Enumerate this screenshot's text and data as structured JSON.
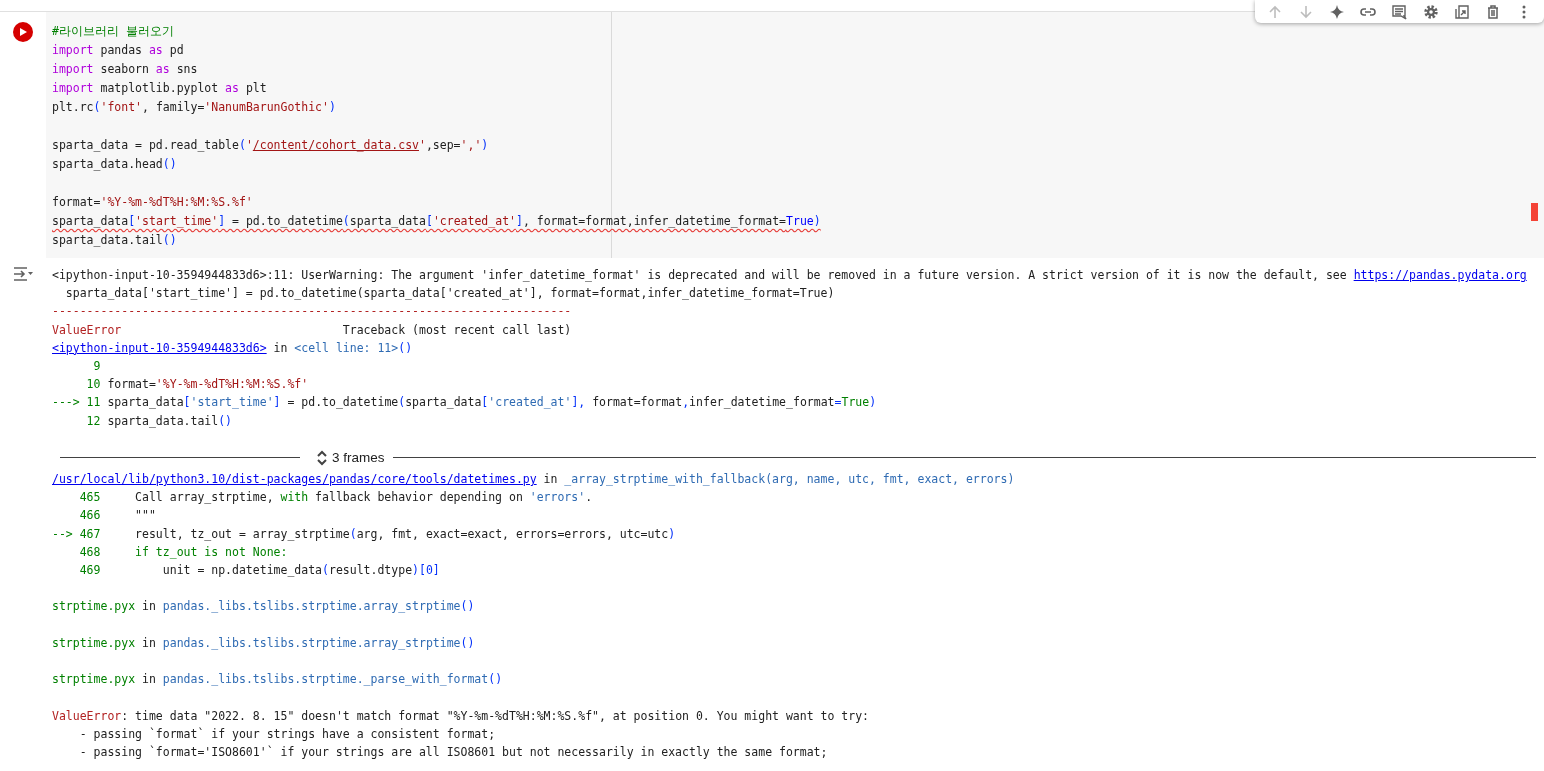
{
  "toolbar": [
    {
      "kind": "move_up",
      "disabled": true
    },
    {
      "kind": "move_down",
      "disabled": true
    },
    {
      "kind": "sparkle",
      "disabled": false
    },
    {
      "kind": "link",
      "disabled": false
    },
    {
      "kind": "comment",
      "disabled": false
    },
    {
      "kind": "settings",
      "disabled": false
    },
    {
      "kind": "mirror",
      "disabled": false
    },
    {
      "kind": "delete",
      "disabled": false
    },
    {
      "kind": "more",
      "disabled": false
    }
  ],
  "cell": {
    "code_blocks": [
      [
        {
          "warning": false,
          "tokens": [
            {
              "kind": "comment",
              "text": "#라이브러리 불러오기"
            }
          ]
        },
        {
          "warning": false,
          "tokens": [
            {
              "kind": "keyword",
              "text": "import"
            },
            " pandas ",
            {
              "kind": "keyword",
              "text": "as"
            },
            " pd"
          ]
        },
        {
          "warning": false,
          "tokens": [
            {
              "kind": "keyword",
              "text": "import"
            },
            " seaborn ",
            {
              "kind": "keyword",
              "text": "as"
            },
            " sns"
          ]
        },
        {
          "warning": false,
          "tokens": [
            {
              "kind": "keyword",
              "text": "import"
            },
            " matplotlib.pyplot ",
            {
              "kind": "keyword",
              "text": "as"
            },
            " plt"
          ]
        },
        {
          "warning": false,
          "tokens": [
            "plt.rc",
            {
              "kind": "paren",
              "text": "("
            },
            {
              "kind": "string",
              "text": "'font'"
            },
            ", family=",
            {
              "kind": "string",
              "text": "'NanumBarunGothic'"
            },
            {
              "kind": "paren",
              "text": ")"
            }
          ]
        }
      ],
      [
        {
          "warning": false,
          "tokens": [
            "sparta_data = pd.read_table",
            {
              "kind": "paren",
              "text": "("
            },
            {
              "kind": "string",
              "text": "'"
            },
            {
              "kind": "path",
              "text": "/content/cohort_data.csv"
            },
            {
              "kind": "string",
              "text": "'"
            },
            ",sep=",
            {
              "kind": "string",
              "text": "','"
            },
            {
              "kind": "paren",
              "text": ")"
            }
          ]
        },
        {
          "warning": false,
          "tokens": [
            "sparta_data.head",
            {
              "kind": "paren",
              "text": "()"
            }
          ]
        }
      ],
      [
        {
          "warning": false,
          "tokens": [
            "format=",
            {
              "kind": "string",
              "text": "'%Y-%m-%dT%H:%M:%S.%f'"
            }
          ]
        },
        {
          "warning": true,
          "tokens": [
            "sparta_data",
            {
              "kind": "paren",
              "text": "["
            },
            {
              "kind": "string",
              "text": "'start_time'"
            },
            {
              "kind": "paren",
              "text": "]"
            },
            " = pd.to_datetime",
            {
              "kind": "paren",
              "text": "("
            },
            "sparta_data",
            {
              "kind": "paren",
              "text": "["
            },
            {
              "kind": "string",
              "text": "'created_at'"
            },
            {
              "kind": "paren",
              "text": "]"
            },
            ", format=format,infer_datetime_format=",
            {
              "kind": "constant",
              "text": "True"
            },
            {
              "kind": "paren",
              "text": ")"
            }
          ]
        },
        {
          "warning": false,
          "tokens": [
            "sparta_data.tail",
            {
              "kind": "paren",
              "text": "()"
            }
          ]
        }
      ]
    ]
  },
  "output": {
    "lines_before": [
      [
        "<ipython-input-10-3594944833d6>:11: UserWarning: The argument 'infer_datetime_format' is deprecated and will be removed in a future version. A strict version of it is now the default, see ",
        {
          "kind": "link",
          "text": "https://pandas.pydata.org"
        }
      ],
      [
        "  sparta_data['start_time'] = pd.to_datetime(sparta_data['created_at'], format=format,infer_datetime_format=True)"
      ],
      [
        {
          "kind": "error",
          "text": "---------------------------------------------------------------------------"
        }
      ],
      [
        {
          "kind": "error",
          "text": "ValueError"
        },
        "                                Traceback (most recent call last)"
      ],
      [
        {
          "kind": "link",
          "text": "<ipython-input-10-3594944833d6>"
        },
        " in ",
        {
          "kind": "name",
          "text": "<cell line: 11>"
        },
        {
          "kind": "paren",
          "text": "()"
        }
      ],
      [
        {
          "kind": "marker",
          "text": "      9"
        }
      ],
      [
        {
          "kind": "marker",
          "text": "     10"
        },
        " format=",
        {
          "kind": "string",
          "text": "'%Y-%m-%dT%H:%M:%S.%f'"
        }
      ],
      [
        {
          "kind": "marker",
          "text": "---> 11"
        },
        " sparta_data",
        {
          "kind": "paren",
          "text": "["
        },
        {
          "kind": "name",
          "text": "'start_time'"
        },
        {
          "kind": "paren",
          "text": "]"
        },
        " = pd.to_datetime",
        {
          "kind": "paren",
          "text": "("
        },
        "sparta_data",
        {
          "kind": "paren",
          "text": "["
        },
        {
          "kind": "name",
          "text": "'created_at'"
        },
        {
          "kind": "paren",
          "text": "],"
        },
        " format=format",
        {
          "kind": "paren",
          "text": ","
        },
        "infer_datetime_format",
        {
          "kind": "paren",
          "text": "="
        },
        {
          "kind": "literal",
          "text": "True"
        },
        {
          "kind": "paren",
          "text": ")"
        }
      ],
      [
        {
          "kind": "marker",
          "text": "     12"
        },
        " sparta_data.tail",
        {
          "kind": "paren",
          "text": "()"
        }
      ]
    ],
    "frames_label": "3 frames",
    "blocks_after": [
      [
        [
          {
            "kind": "link",
            "text": "/usr/local/lib/python3.10/dist-packages/pandas/core/tools/datetimes.py"
          },
          " in ",
          {
            "kind": "name",
            "text": "_array_strptime_with_fallback(arg, name, utc, fmt, exact, errors)"
          }
        ],
        [
          {
            "kind": "marker",
            "text": "    465"
          },
          "     Call array_strptime, ",
          {
            "kind": "literal",
            "text": "with"
          },
          " fallback behavior depending on ",
          {
            "kind": "name",
            "text": "'errors'"
          },
          "."
        ],
        [
          {
            "kind": "marker",
            "text": "    466"
          },
          "     \"\"\""
        ],
        [
          {
            "kind": "marker",
            "text": "--> 467"
          },
          "     result, tz_out = array_strptime",
          {
            "kind": "paren",
            "text": "("
          },
          "arg, fmt, exact=exact, errors=errors, utc=utc",
          {
            "kind": "paren",
            "text": ")"
          }
        ],
        [
          {
            "kind": "marker",
            "text": "    468"
          },
          {
            "kind": "literal",
            "text": "     if tz_out is not None:"
          }
        ],
        [
          {
            "kind": "marker",
            "text": "    469"
          },
          "         unit = np.datetime_data",
          {
            "kind": "paren",
            "text": "("
          },
          "result.dtype",
          {
            "kind": "paren",
            "text": ")[0]"
          }
        ]
      ],
      [
        [
          {
            "kind": "literal",
            "text": "strptime.pyx"
          },
          " in ",
          {
            "kind": "name",
            "text": "pandas._libs.tslibs.strptime.array_strptime"
          },
          {
            "kind": "paren",
            "text": "()"
          }
        ]
      ],
      [
        [
          {
            "kind": "literal",
            "text": "strptime.pyx"
          },
          " in ",
          {
            "kind": "name",
            "text": "pandas._libs.tslibs.strptime.array_strptime"
          },
          {
            "kind": "paren",
            "text": "()"
          }
        ]
      ],
      [
        [
          {
            "kind": "literal",
            "text": "strptime.pyx"
          },
          " in ",
          {
            "kind": "name",
            "text": "pandas._libs.tslibs.strptime._parse_with_format"
          },
          {
            "kind": "paren",
            "text": "()"
          }
        ]
      ],
      [
        [
          {
            "kind": "error",
            "text": "ValueError"
          },
          ": time data \"2022. 8. 15\" doesn't match format \"%Y-%m-%dT%H:%M:%S.%f\", at position 0. You might want to try:"
        ],
        [
          "    - passing `format` if your strings have a consistent format;"
        ],
        [
          "    - passing `format='ISO8601'` if your strings are all ISO8601 but not necessarily in exactly the same format;"
        ]
      ]
    ]
  }
}
